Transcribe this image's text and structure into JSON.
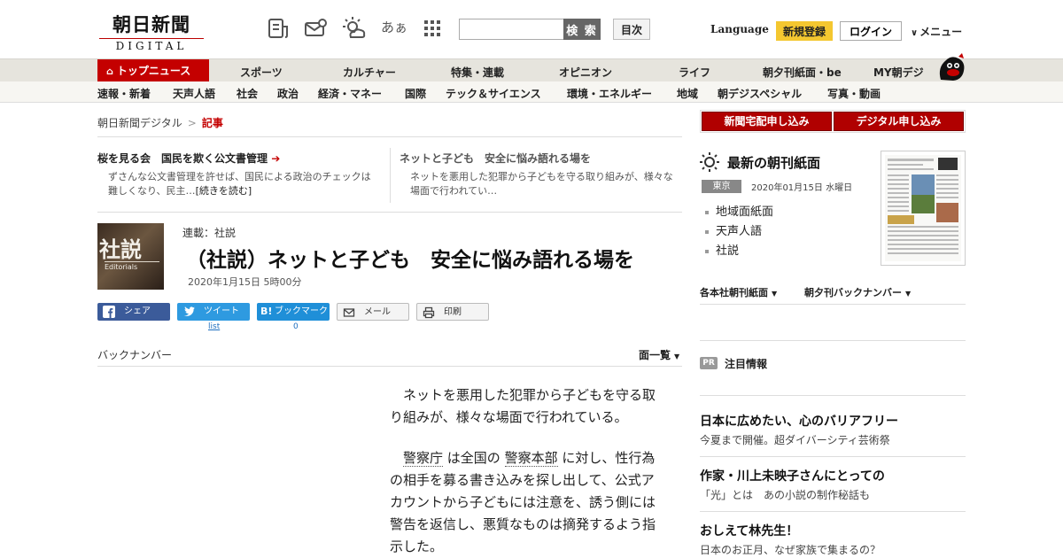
{
  "header": {
    "logo_main": "朝日新聞",
    "logo_sub": "DIGITAL",
    "icons": [
      "newspaper-icon",
      "mail-icon",
      "weather-icon",
      "font-size-icon",
      "grid-icon"
    ],
    "font_size_label": "あぁ",
    "search_placeholder": "",
    "search_button": "検 索",
    "index_button": "目次",
    "language": "Language",
    "signup": "新規登録",
    "login": "ログイン",
    "menu": "メニュー"
  },
  "nav_primary": {
    "top_news": "トップニュース",
    "items": [
      "スポーツ",
      "カルチャー",
      "特集・連載",
      "オピニオン",
      "ライフ",
      "朝夕刊紙面・be",
      "MY朝デジ"
    ]
  },
  "nav_secondary": {
    "items": [
      "速報・新着",
      "天声人語",
      "社会",
      "政治",
      "経済・マネー",
      "国際",
      "テック＆サイエンス",
      "環境・エネルギー",
      "地域",
      "朝デジスペシャル",
      "写真・動画"
    ]
  },
  "breadcrumb": {
    "home": "朝日新聞デジタル",
    "current": "記事"
  },
  "teasers": [
    {
      "title": "桜を見る会　国民を欺く公文書管理",
      "arrow": "➔",
      "body": "ずさんな公文書管理を許せば、国民による政治のチェックは難しくなり、民主…",
      "more": "[続きを読む]"
    },
    {
      "title": "ネットと子ども　安全に悩み語れる場を",
      "body": "ネットを悪用した犯罪から子どもを守る取り組みが、様々な場面で行われてい…"
    }
  ],
  "article": {
    "image_big": "社説",
    "image_small": "Editorials",
    "series": "連載：社説",
    "headline": "（社説）ネットと子ども　安全に悩み語れる場を",
    "date": "2020年1月15日 5時00分",
    "share": {
      "facebook": "シェア",
      "twitter": "ツイート",
      "hatena": "ブックマーク",
      "hatena_badge": "B!",
      "mail": "メール",
      "print": "印刷",
      "twitter_count": "list",
      "hatena_count": "0"
    },
    "backnumber": "バックナンバー",
    "page_list": "面一覧",
    "paragraphs": {
      "p1": "ネットを悪用した犯罪から子どもを守る取り組みが、様々な場面で行われている。",
      "p2_link1": "警察庁",
      "p2_mid": "は全国の",
      "p2_link2": "警察本部",
      "p2_rest": "に対し、性行為の相手を募る書き込みを探し出して、公式アカウントから子どもには注意を、誘う側には警告を返信し、悪質なものは摘発するよう指示した。"
    }
  },
  "sidebar": {
    "subscribe_paper": "新聞宅配申し込み",
    "subscribe_digital": "デジタル申し込み",
    "paper_title": "最新の朝刊紙面",
    "region": "東京",
    "paper_date": "2020年01月15日 水曜日",
    "paper_links": [
      "地域面紙面",
      "天声人語",
      "社説"
    ],
    "dropdown1": "各本社朝刊紙面",
    "dropdown2": "朝夕刊バックナンバー",
    "pr_tag": "PR",
    "pr_title": "注目情報",
    "pr_items": [
      {
        "headline": "日本に広めたい、心のバリアフリー",
        "sub": "今夏まで開催。超ダイバーシティ芸術祭"
      },
      {
        "headline": "作家・川上未映子さんにとっての",
        "sub": "「光」とは　あの小説の制作秘話も"
      },
      {
        "headline": "おしえて林先生！",
        "sub": "日本のお正月、なぜ家族で集まるの？"
      }
    ]
  },
  "colors": {
    "brand_red": "#c40000",
    "signup_yellow": "#f4c730",
    "facebook": "#3b5b9a",
    "twitter": "#2e9ae0",
    "hatena": "#1f8fd8"
  }
}
